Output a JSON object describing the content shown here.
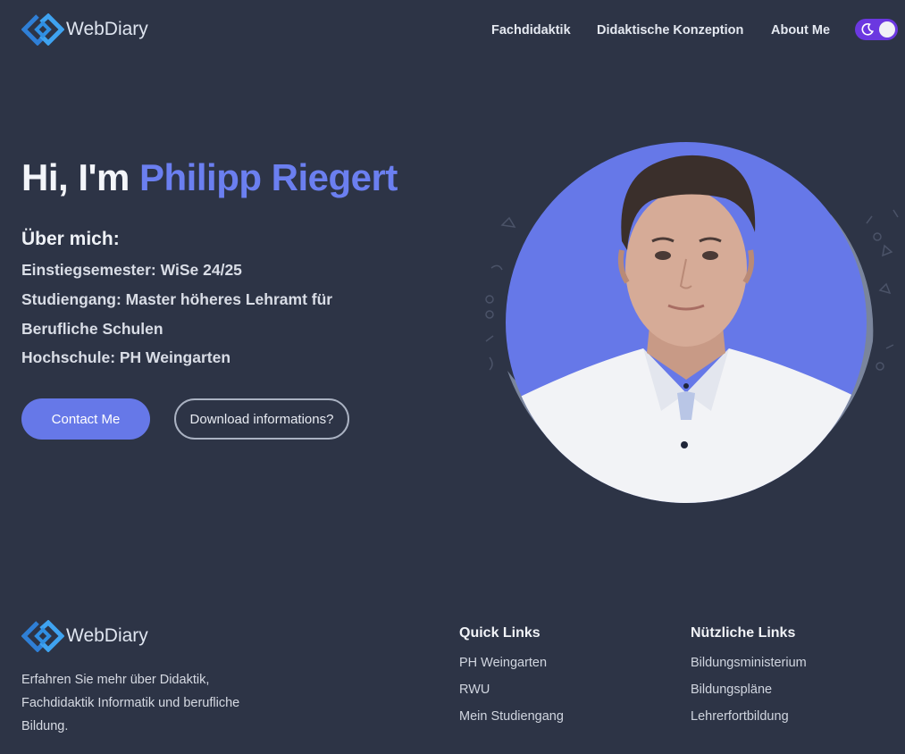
{
  "header": {
    "logo_text": "WebDiary",
    "nav": [
      {
        "label": "Fachdidaktik"
      },
      {
        "label": "Didaktische Konzeption"
      },
      {
        "label": "About Me"
      }
    ],
    "theme_toggle": {
      "icon": "moon-icon",
      "state": "dark"
    }
  },
  "hero": {
    "greeting": "Hi, I'm ",
    "name": "Philipp Riegert",
    "about_heading": "Über mich:",
    "info_lines": [
      "Einstiegsemester: WiSe 24/25",
      "Studiengang: Master höheres Lehramt für",
      "Berufliche Schulen",
      "Hochschule: PH Weingarten"
    ],
    "contact_button": "Contact Me",
    "download_button": "Download informations?"
  },
  "footer": {
    "logo_text": "WebDiary",
    "description": "Erfahren Sie mehr über Didaktik, Fachdidaktik Informatik und berufliche Bildung.",
    "quick_links": {
      "title": "Quick Links",
      "items": [
        "PH Weingarten",
        "RWU",
        "Mein Studiengang"
      ]
    },
    "useful_links": {
      "title": "Nützliche Links",
      "items": [
        "Bildungsministerium",
        "Bildungspläne",
        "Lehrerfortbildung"
      ]
    }
  },
  "colors": {
    "background": "#2d3446",
    "accent": "#6678e8",
    "name_highlight": "#6b7ff0",
    "toggle": "#6b38e0",
    "portrait_shadow": "#7a859c"
  }
}
